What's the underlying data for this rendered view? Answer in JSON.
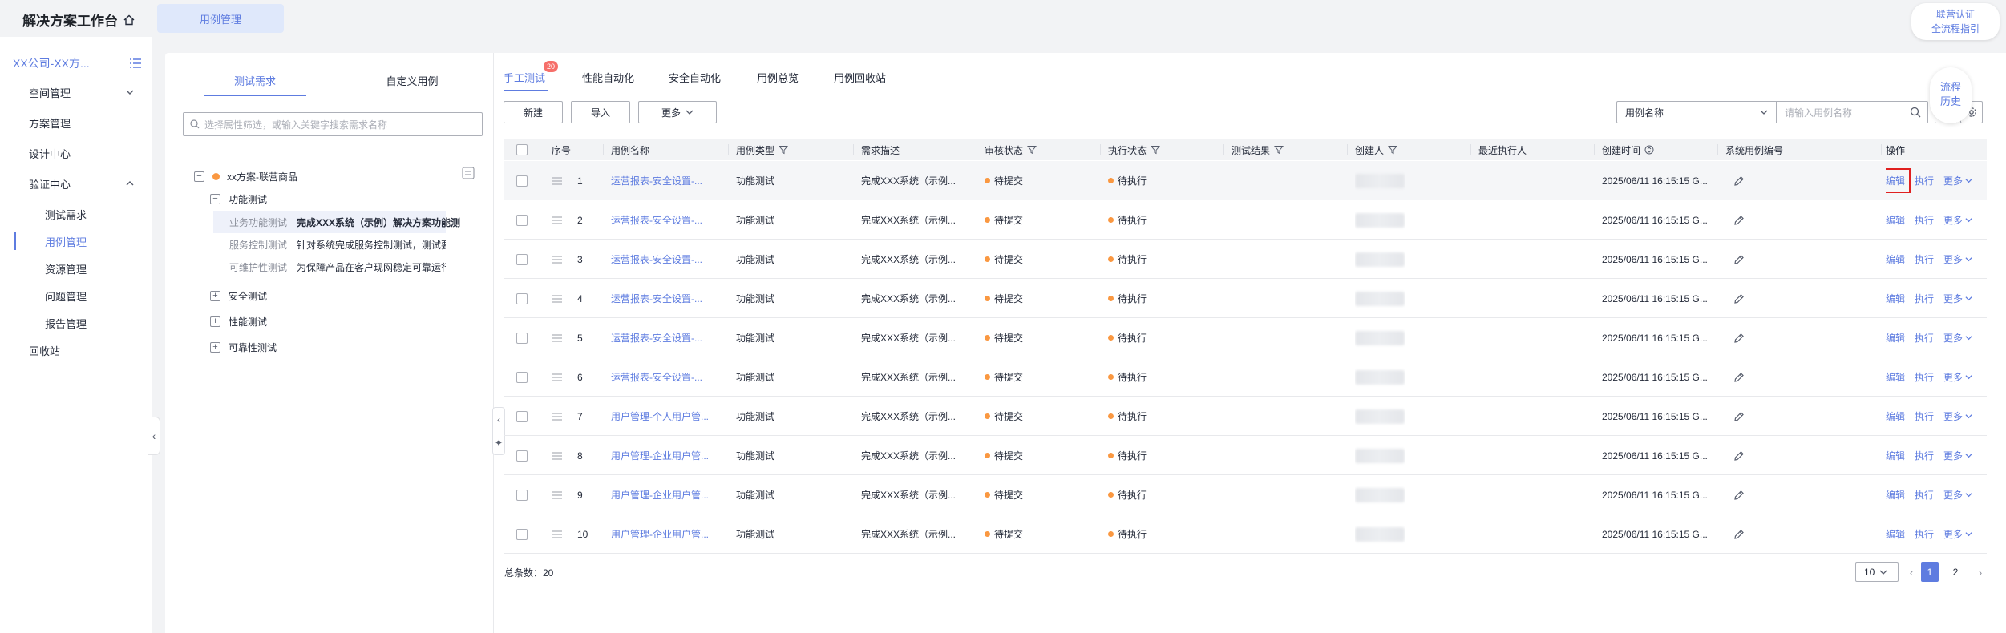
{
  "header": {
    "app_title": "解决方案工作台",
    "active_tab": "用例管理",
    "float_link_line1": "联营认证",
    "float_link_line2": "全流程指引"
  },
  "sidebar": {
    "project": "XX公司-XX方...",
    "items": [
      {
        "label": "空间管理",
        "expandable": true
      },
      {
        "label": "方案管理"
      },
      {
        "label": "设计中心"
      },
      {
        "label": "验证中心",
        "expandable": true,
        "expanded": true
      },
      {
        "label": "测试需求",
        "sub": true
      },
      {
        "label": "用例管理",
        "sub": true,
        "active": true
      },
      {
        "label": "资源管理",
        "sub": true
      },
      {
        "label": "问题管理",
        "sub": true
      },
      {
        "label": "报告管理",
        "sub": true
      },
      {
        "label": "回收站"
      }
    ]
  },
  "tree": {
    "tabs": [
      "测试需求",
      "自定义用例"
    ],
    "search_placeholder": "选择属性筛选，或输入关键字搜索需求名称",
    "root": "xx方案-联营商品",
    "group": "功能测试",
    "leaves": [
      {
        "name": "业务功能测试",
        "desc": "完成XXX系统（示例）解决方案功能测"
      },
      {
        "name": "服务控制测试",
        "desc": "针对系统完成服务控制测试，测试要求"
      },
      {
        "name": "可维护性测试",
        "desc": "为保障产品在客户现网稳定可靠运行，:"
      }
    ],
    "other_groups": [
      "安全测试",
      "性能测试",
      "可靠性测试"
    ]
  },
  "content": {
    "tabs": [
      "手工测试",
      "性能自动化",
      "安全自动化",
      "用例总览",
      "用例回收站"
    ],
    "badge": "20",
    "toolbar": {
      "new": "新建",
      "import": "导入",
      "more": "更多"
    },
    "filter_select": "用例名称",
    "search_placeholder": "请输入用例名称",
    "float_process_line1": "流程",
    "float_process_line2": "历史"
  },
  "table": {
    "columns": [
      "序号",
      "用例名称",
      "用例类型",
      "需求描述",
      "审核状态",
      "执行状态",
      "测试结果",
      "创建人",
      "最近执行人",
      "创建时间",
      "系统用例编号",
      "操作"
    ],
    "rows": [
      {
        "no": "1",
        "name": "运营报表-安全设置-...",
        "type": "功能测试",
        "desc": "完成XXX系统（示例...",
        "review": "待提交",
        "exec": "待执行",
        "time": "2025/06/11 16:15:15 G..."
      },
      {
        "no": "2",
        "name": "运营报表-安全设置-...",
        "type": "功能测试",
        "desc": "完成XXX系统（示例...",
        "review": "待提交",
        "exec": "待执行",
        "time": "2025/06/11 16:15:15 G..."
      },
      {
        "no": "3",
        "name": "运营报表-安全设置-...",
        "type": "功能测试",
        "desc": "完成XXX系统（示例...",
        "review": "待提交",
        "exec": "待执行",
        "time": "2025/06/11 16:15:15 G..."
      },
      {
        "no": "4",
        "name": "运营报表-安全设置-...",
        "type": "功能测试",
        "desc": "完成XXX系统（示例...",
        "review": "待提交",
        "exec": "待执行",
        "time": "2025/06/11 16:15:15 G..."
      },
      {
        "no": "5",
        "name": "运营报表-安全设置-...",
        "type": "功能测试",
        "desc": "完成XXX系统（示例...",
        "review": "待提交",
        "exec": "待执行",
        "time": "2025/06/11 16:15:15 G..."
      },
      {
        "no": "6",
        "name": "运营报表-安全设置-...",
        "type": "功能测试",
        "desc": "完成XXX系统（示例...",
        "review": "待提交",
        "exec": "待执行",
        "time": "2025/06/11 16:15:15 G..."
      },
      {
        "no": "7",
        "name": "用户管理-个人用户管...",
        "type": "功能测试",
        "desc": "完成XXX系统（示例...",
        "review": "待提交",
        "exec": "待执行",
        "time": "2025/06/11 16:15:15 G..."
      },
      {
        "no": "8",
        "name": "用户管理-企业用户管...",
        "type": "功能测试",
        "desc": "完成XXX系统（示例...",
        "review": "待提交",
        "exec": "待执行",
        "time": "2025/06/11 16:15:15 G..."
      },
      {
        "no": "9",
        "name": "用户管理-企业用户管...",
        "type": "功能测试",
        "desc": "完成XXX系统（示例...",
        "review": "待提交",
        "exec": "待执行",
        "time": "2025/06/11 16:15:15 G..."
      },
      {
        "no": "10",
        "name": "用户管理-企业用户管...",
        "type": "功能测试",
        "desc": "完成XXX系统（示例...",
        "review": "待提交",
        "exec": "待执行",
        "time": "2025/06/11 16:15:15 G..."
      }
    ],
    "ops": {
      "edit": "编辑",
      "run": "执行",
      "more": "更多"
    }
  },
  "footer": {
    "total": "总条数：20",
    "page_size": "10",
    "pages": [
      "1",
      "2"
    ],
    "current_page": "1"
  },
  "colors": {
    "accent": "#5e7ce0",
    "warning": "#fa9841",
    "badge": "#f66f6a",
    "highlight_box": "#e02020"
  }
}
